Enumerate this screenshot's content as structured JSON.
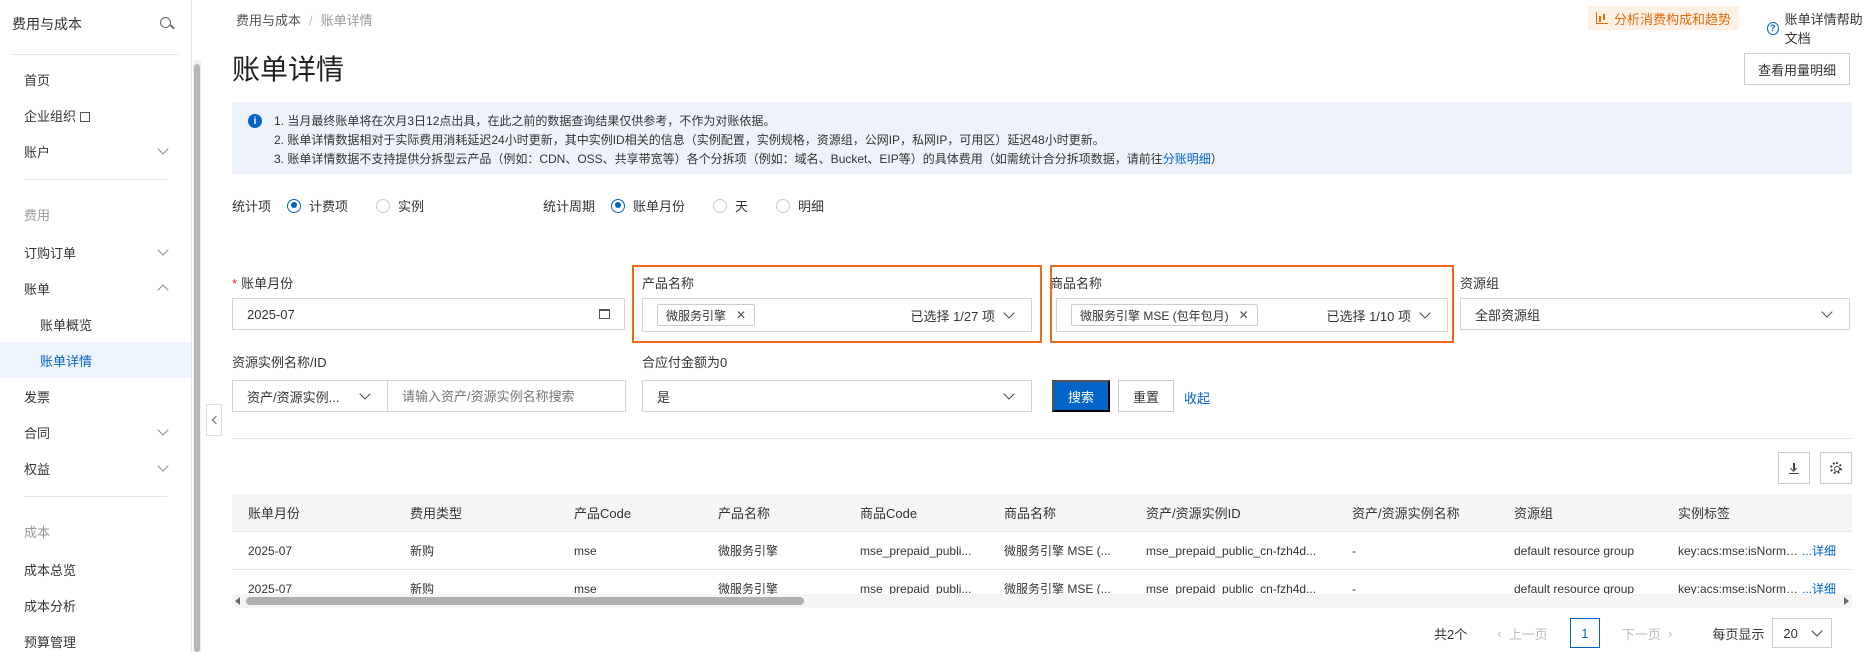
{
  "sidebar": {
    "title": "费用与成本",
    "items": [
      {
        "label": "首页"
      },
      {
        "label": "企业组织"
      },
      {
        "label": "账户"
      }
    ],
    "group_fee": "费用",
    "fee_items": [
      {
        "label": "订购订单"
      },
      {
        "label": "账单"
      },
      {
        "label": "账单概览"
      },
      {
        "label": "账单详情"
      },
      {
        "label": "发票"
      },
      {
        "label": "合同"
      },
      {
        "label": "权益"
      }
    ],
    "group_cost": "成本",
    "cost_items": [
      {
        "label": "成本总览"
      },
      {
        "label": "成本分析"
      },
      {
        "label": "预算管理"
      }
    ]
  },
  "breadcrumb": {
    "root": "费用与成本",
    "sep": "/",
    "current": "账单详情"
  },
  "top_actions": {
    "analyze": "分析消费构成和趋势",
    "help": "账单详情帮助文档"
  },
  "page_title": "账单详情",
  "usage_button": "查看用量明细",
  "notice": {
    "line1": "1. 当月最终账单将在次月3日12点出具，在此之前的数据查询结果仅供参考，不作为对账依据。",
    "line2": "2. 账单详情数据相对于实际费用消耗延迟24小时更新，其中实例ID相关的信息（实例配置，实例规格，资源组，公网IP，私网IP，可用区）延迟48小时更新。",
    "line3_pre": "3. 账单详情数据不支持提供分拆型云产品（例如：CDN、OSS、共享带宽等）各个分拆项（例如：域名、Bucket、EIP等）的具体费用（如需统计合分拆项数据，请前往",
    "line3_link": "分账明细",
    "line3_post": "）"
  },
  "stat_item": {
    "label": "统计项",
    "options": [
      "计费项",
      "实例"
    ],
    "selected": "计费项"
  },
  "stat_period": {
    "label": "统计周期",
    "options": [
      "账单月份",
      "天",
      "明细"
    ],
    "selected": "账单月份"
  },
  "filters": {
    "bill_month": {
      "label": "账单月份",
      "value": "2025-07"
    },
    "product": {
      "label": "产品名称",
      "tag": "微服务引擎",
      "count": "已选择 1/27 项"
    },
    "commodity": {
      "label": "商品名称",
      "tag": "微服务引擎 MSE (包年包月)",
      "count": "已选择 1/10 项"
    },
    "resource_group": {
      "label": "资源组",
      "value": "全部资源组"
    },
    "instance": {
      "label": "资源实例名称/ID",
      "type_value": "资产/资源实例...",
      "placeholder": "请输入资产/资源实例名称搜索"
    },
    "zero_amount": {
      "label": "合应付金额为0",
      "value": "是"
    }
  },
  "buttons": {
    "search": "搜索",
    "reset": "重置",
    "collapse": "收起"
  },
  "table": {
    "columns": [
      "账单月份",
      "费用类型",
      "产品Code",
      "产品名称",
      "商品Code",
      "商品名称",
      "资产/资源实例ID",
      "资产/资源实例名称",
      "资源组",
      "实例标签"
    ],
    "rows": [
      [
        "2025-07",
        "新购",
        "mse",
        "微服务引擎",
        "mse_prepaid_publi...",
        "微服务引擎 MSE (...",
        "mse_prepaid_public_cn-fzh4d...",
        "-",
        "default resource group",
        "key:acs:mse:isNormand..."
      ],
      [
        "2025-07",
        "新购",
        "mse",
        "微服务引擎",
        "mse_prepaid_publi...",
        "微服务引擎 MSE (...",
        "mse_prepaid_public_cn-fzh4d...",
        "-",
        "default resource group",
        "key:acs:mse:isNormand..."
      ]
    ],
    "detail_link": "...详细"
  },
  "pager": {
    "total": "共2个",
    "prev": "上一页",
    "page": "1",
    "next": "下一页",
    "page_size_label": "每页显示",
    "page_size": "20"
  },
  "colors": {
    "accent": "#0064c8",
    "highlight": "#f06a1d"
  }
}
